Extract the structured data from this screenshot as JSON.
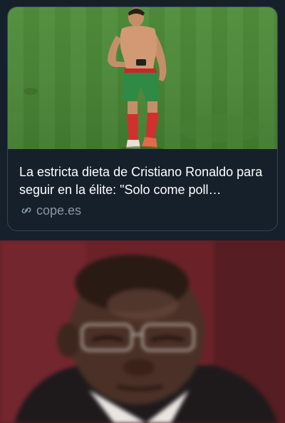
{
  "link_card": {
    "title": "La estricta dieta de Cristiano Ronaldo para seguir en la élite: \"Solo come poll…",
    "domain": "cope.es",
    "image_alt": "Footballer on pitch",
    "link_icon": "link-icon"
  },
  "meme_image": {
    "alt": "Reaction image of a man looking down"
  },
  "colors": {
    "background": "#15202b",
    "border": "#38444d",
    "title_text": "#ffffff",
    "domain_text": "#8899a6"
  }
}
